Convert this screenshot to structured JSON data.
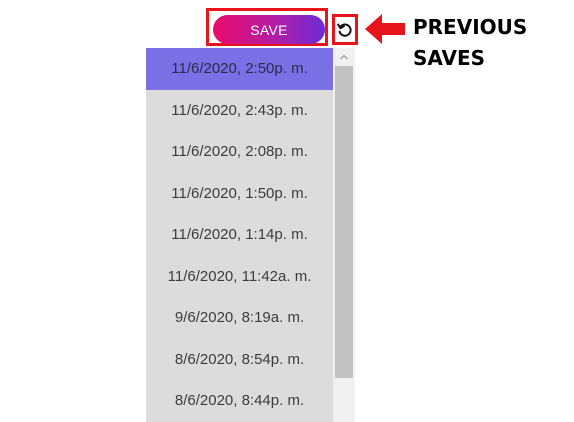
{
  "toolbar": {
    "save_label": "SAVE"
  },
  "history_icon": {
    "name": "history-icon"
  },
  "annotation": {
    "line1": "PREVIOUS",
    "line2": "SAVES"
  },
  "previous_saves": {
    "items": [
      "11/6/2020, 2:50p. m.",
      "11/6/2020, 2:43p. m.",
      "11/6/2020, 2:08p. m.",
      "11/6/2020, 1:50p. m.",
      "11/6/2020, 1:14p. m.",
      "11/6/2020, 11:42a. m.",
      "9/6/2020, 8:19a. m.",
      "8/6/2020, 8:54p. m.",
      "8/6/2020, 8:44p. m."
    ],
    "selected_index": 0
  },
  "colors": {
    "annotation_red": "#e8141c",
    "save_gradient_start": "#ea0b6a",
    "save_gradient_end": "#6b2bd8",
    "selected_item": "#7a6fe4",
    "list_background": "#dcdcdc"
  }
}
